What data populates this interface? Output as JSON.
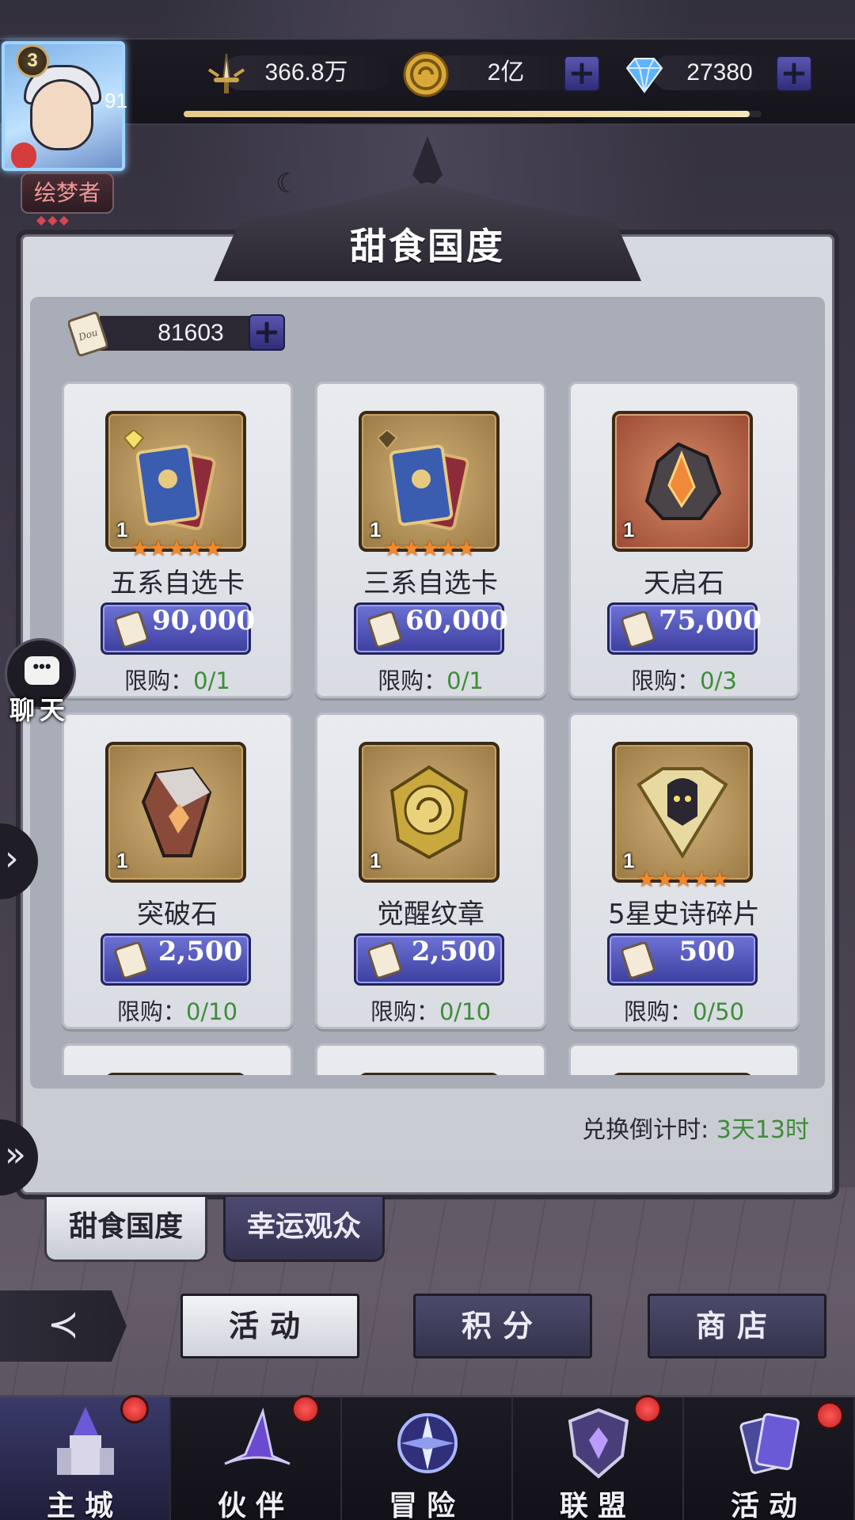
{
  "player": {
    "level": "3",
    "level_ring": "91",
    "title": "绘梦者",
    "exp_fraction": 0.98
  },
  "resources": {
    "power": "366.8万",
    "gold": "2亿",
    "diamonds": "27380"
  },
  "panel": {
    "title": "甜食国度",
    "dou_balance": "81603",
    "countdown_label": "兑换倒计时: ",
    "countdown_value": "3天13时"
  },
  "shop_items": [
    {
      "name": "五系自选卡",
      "qty": "1",
      "stars": "★★★★★",
      "price": "90,000",
      "limit_label": "限购：",
      "limit": "0/1",
      "art": "card-pack-icon"
    },
    {
      "name": "三系自选卡",
      "qty": "1",
      "stars": "★★★★★",
      "price": "60,000",
      "limit_label": "限购：",
      "limit": "0/1",
      "art": "card-pack-icon"
    },
    {
      "name": "天启石",
      "qty": "1",
      "stars": "",
      "price": "75,000",
      "limit_label": "限购：",
      "limit": "0/3",
      "art": "apocalypse-stone-icon"
    },
    {
      "name": "突破石",
      "qty": "1",
      "stars": "",
      "price": "2,500",
      "limit_label": "限购：",
      "limit": "0/10",
      "art": "breakthrough-stone-icon"
    },
    {
      "name": "觉醒纹章",
      "qty": "1",
      "stars": "",
      "price": "2,500",
      "limit_label": "限购：",
      "limit": "0/10",
      "art": "awakening-emblem-icon"
    },
    {
      "name": "5星史诗碎片",
      "qty": "1",
      "stars": "★★★★★",
      "price": "500",
      "limit_label": "限购：",
      "limit": "0/50",
      "art": "epic-shard-icon"
    }
  ],
  "tabs": [
    "甜食国度",
    "幸运观众"
  ],
  "subnav": [
    "活动",
    "积分",
    "商店"
  ],
  "bottom_nav": [
    "主城",
    "伙伴",
    "冒险",
    "联盟",
    "活动"
  ],
  "chat": {
    "label": "聊天",
    "bubble": "•••"
  },
  "icons": {
    "plus": "+",
    "dou": "Dou",
    "back": "≺",
    "expand": "›",
    "expand_double": "»"
  },
  "colors": {
    "accent": "#3c3f9e",
    "limit_count": "#3e8c3a",
    "red_dot": "#d42a2a"
  }
}
